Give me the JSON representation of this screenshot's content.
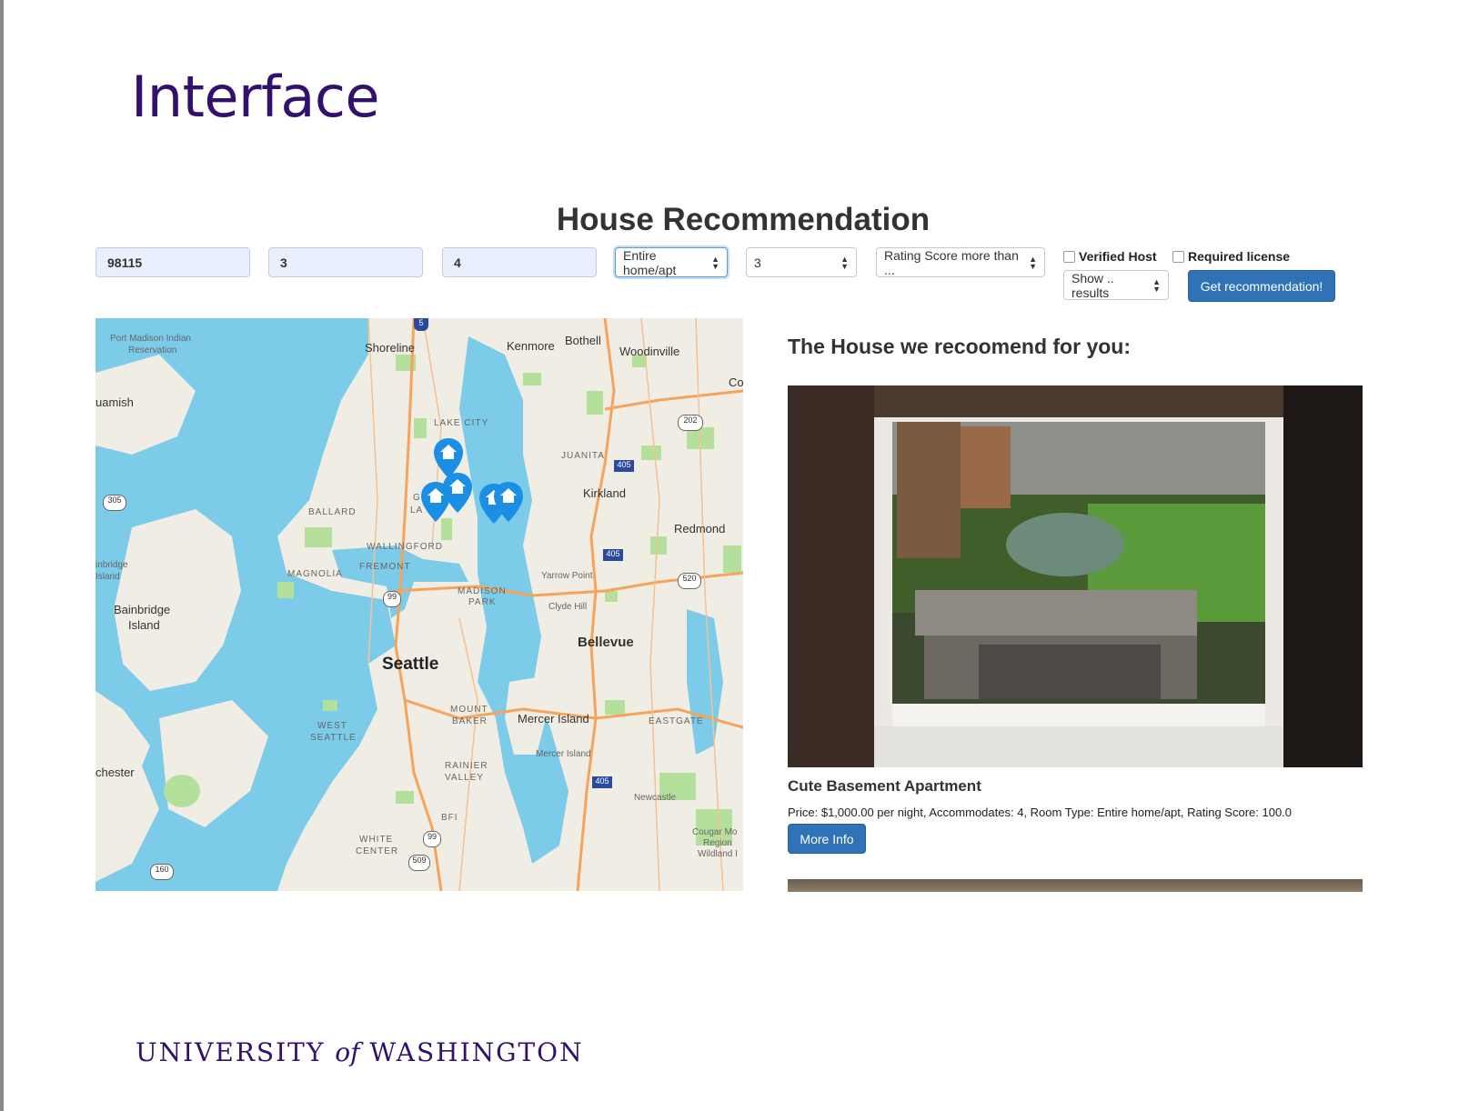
{
  "slide": {
    "title": "Interface",
    "footer": {
      "university": "UNIVERSITY",
      "of": "of",
      "state": "WASHINGTON"
    }
  },
  "app": {
    "title": "House Recommendation",
    "inputs": {
      "zipcode": "98115",
      "bedrooms": "3",
      "accommodates": "4",
      "room_type": "Entire home/apt",
      "bathrooms": "3",
      "rating": "Rating Score more than ...",
      "results": "Show .. results"
    },
    "checkboxes": {
      "verified_host": "Verified Host",
      "required_license": "Required license"
    },
    "submit_label": "Get recommendation!"
  },
  "map": {
    "labels": {
      "port_madison": "Port Madison Indian",
      "reservation": "Reservation",
      "shoreline": "Shoreline",
      "kenmore": "Kenmore",
      "bothell": "Bothell",
      "woodinville": "Woodinville",
      "co": "Co",
      "suquamish": "uamish",
      "lake_city": "LAKE CITY",
      "juanita": "JUANITA",
      "kirkland": "Kirkland",
      "ballard": "BALLARD",
      "redmond": "Redmond",
      "wallingford": "WALLINGFORD",
      "fremont": "FREMONT",
      "magnolia": "MAGNOLIA",
      "bainbridge_clip": "inbridge",
      "island_clip": "Island",
      "yarrow_point": "Yarrow Point",
      "madison": "MADISON",
      "park": "PARK",
      "clyde_hill": "Clyde Hill",
      "bainbridge": "Bainbridge",
      "bainbridge_island": "Island",
      "bellevue": "Bellevue",
      "seattle": "Seattle",
      "mount": "MOUNT",
      "baker": "BAKER",
      "mercer_island": "Mercer Island",
      "eastgate": "EASTGATE",
      "west": "WEST",
      "seattle_w": "SEATTLE",
      "mercer_island_small": "Mercer Island",
      "rainier": "RAINIER",
      "valley": "VALLEY",
      "manchester": "chester",
      "newcastle": "Newcastle",
      "bfi": "BFI",
      "cougar": "Cougar Mo",
      "region": "Region",
      "wildland": "Wildland I",
      "white": "WHITE",
      "center": "CENTER",
      "gr": "GR",
      "la": "LA"
    },
    "shields": [
      "5",
      "202",
      "405",
      "305",
      "405",
      "520",
      "99",
      "405",
      "99",
      "509",
      "160"
    ]
  },
  "recommendation": {
    "heading": "The House we recoomend for you:",
    "name": "Cute Basement Apartment",
    "details": "Price: $1,000.00 per night, Accommodates: 4, Room Type: Entire home/apt, Rating Score: 100.0",
    "button": "More Info"
  },
  "colors": {
    "uw_purple": "#32106e",
    "button_blue": "#2f72b7",
    "marker_blue": "#1a8fe3",
    "water": "#7ccbe9"
  }
}
